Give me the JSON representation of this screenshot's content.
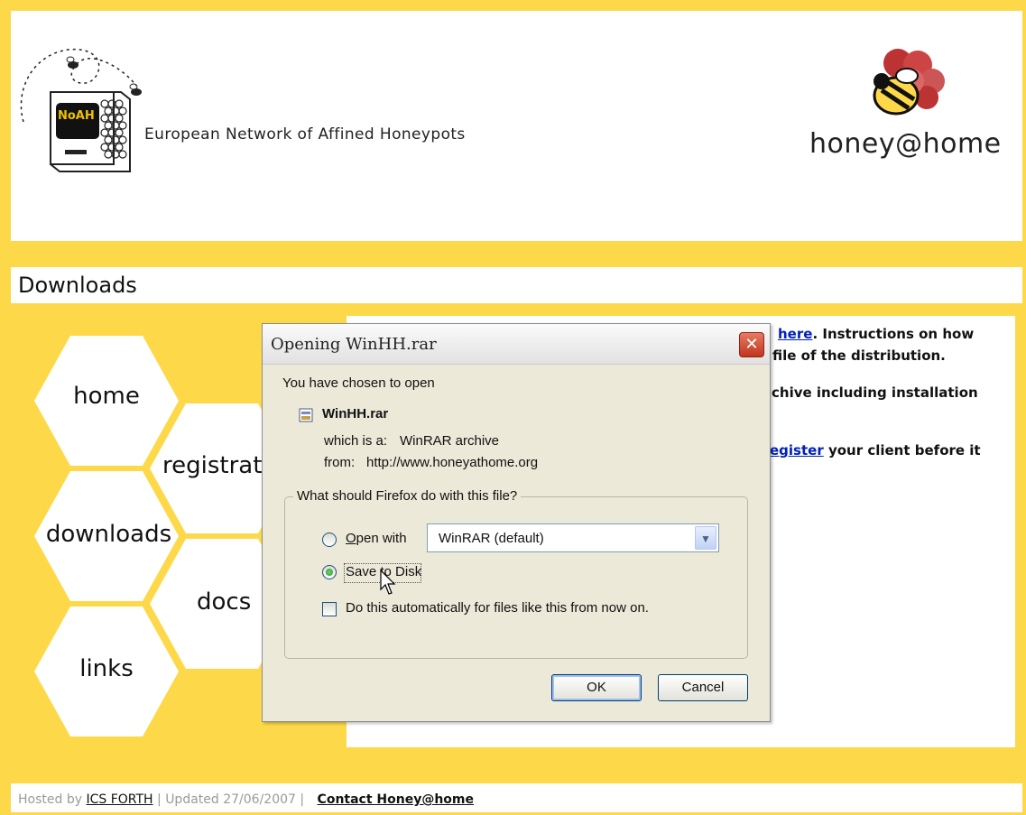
{
  "header": {
    "title": "European Network of Affined Honeypots",
    "logo_left_text": "NoAH",
    "logo_right_text": "honey@home"
  },
  "section": {
    "title": "Downloads"
  },
  "nav": {
    "items": [
      {
        "label": "home"
      },
      {
        "label": "registrati"
      },
      {
        "label": "downloads"
      },
      {
        "label": "docs"
      },
      {
        "label": "links"
      }
    ]
  },
  "content": {
    "line1_link": "here",
    "line1_text": ". Instructions on how",
    "line2_text": "file of the distribution.",
    "line3_text": "chive including installation",
    "line4_link": "egister",
    "line4_text": " your client before it"
  },
  "dialog": {
    "title": "Opening WinHH.rar",
    "intro": "You have chosen to open",
    "filename": "WinHH.rar",
    "which_is_label": "which is a:",
    "which_is_value": "WinRAR archive",
    "from_label": "from:",
    "from_value": "http://www.honeyathome.org",
    "group_label": "What should Firefox do with this file?",
    "open_with_label": "Open with",
    "open_with_selected": "WinRAR (default)",
    "save_to_disk_label": "Save to Disk",
    "auto_label": "Do this automatically for files like this from now on.",
    "ok_label": "OK",
    "cancel_label": "Cancel",
    "selected_option": "save_to_disk",
    "auto_checked": false
  },
  "footer": {
    "hosted_by": "Hosted by",
    "host_link": "ICS FORTH",
    "separator": "|",
    "updated": "Updated 27/06/2007",
    "contact_link": "Contact Honey@home"
  },
  "colors": {
    "brand_yellow": "#fdd94a",
    "link_blue": "#0020b8"
  }
}
